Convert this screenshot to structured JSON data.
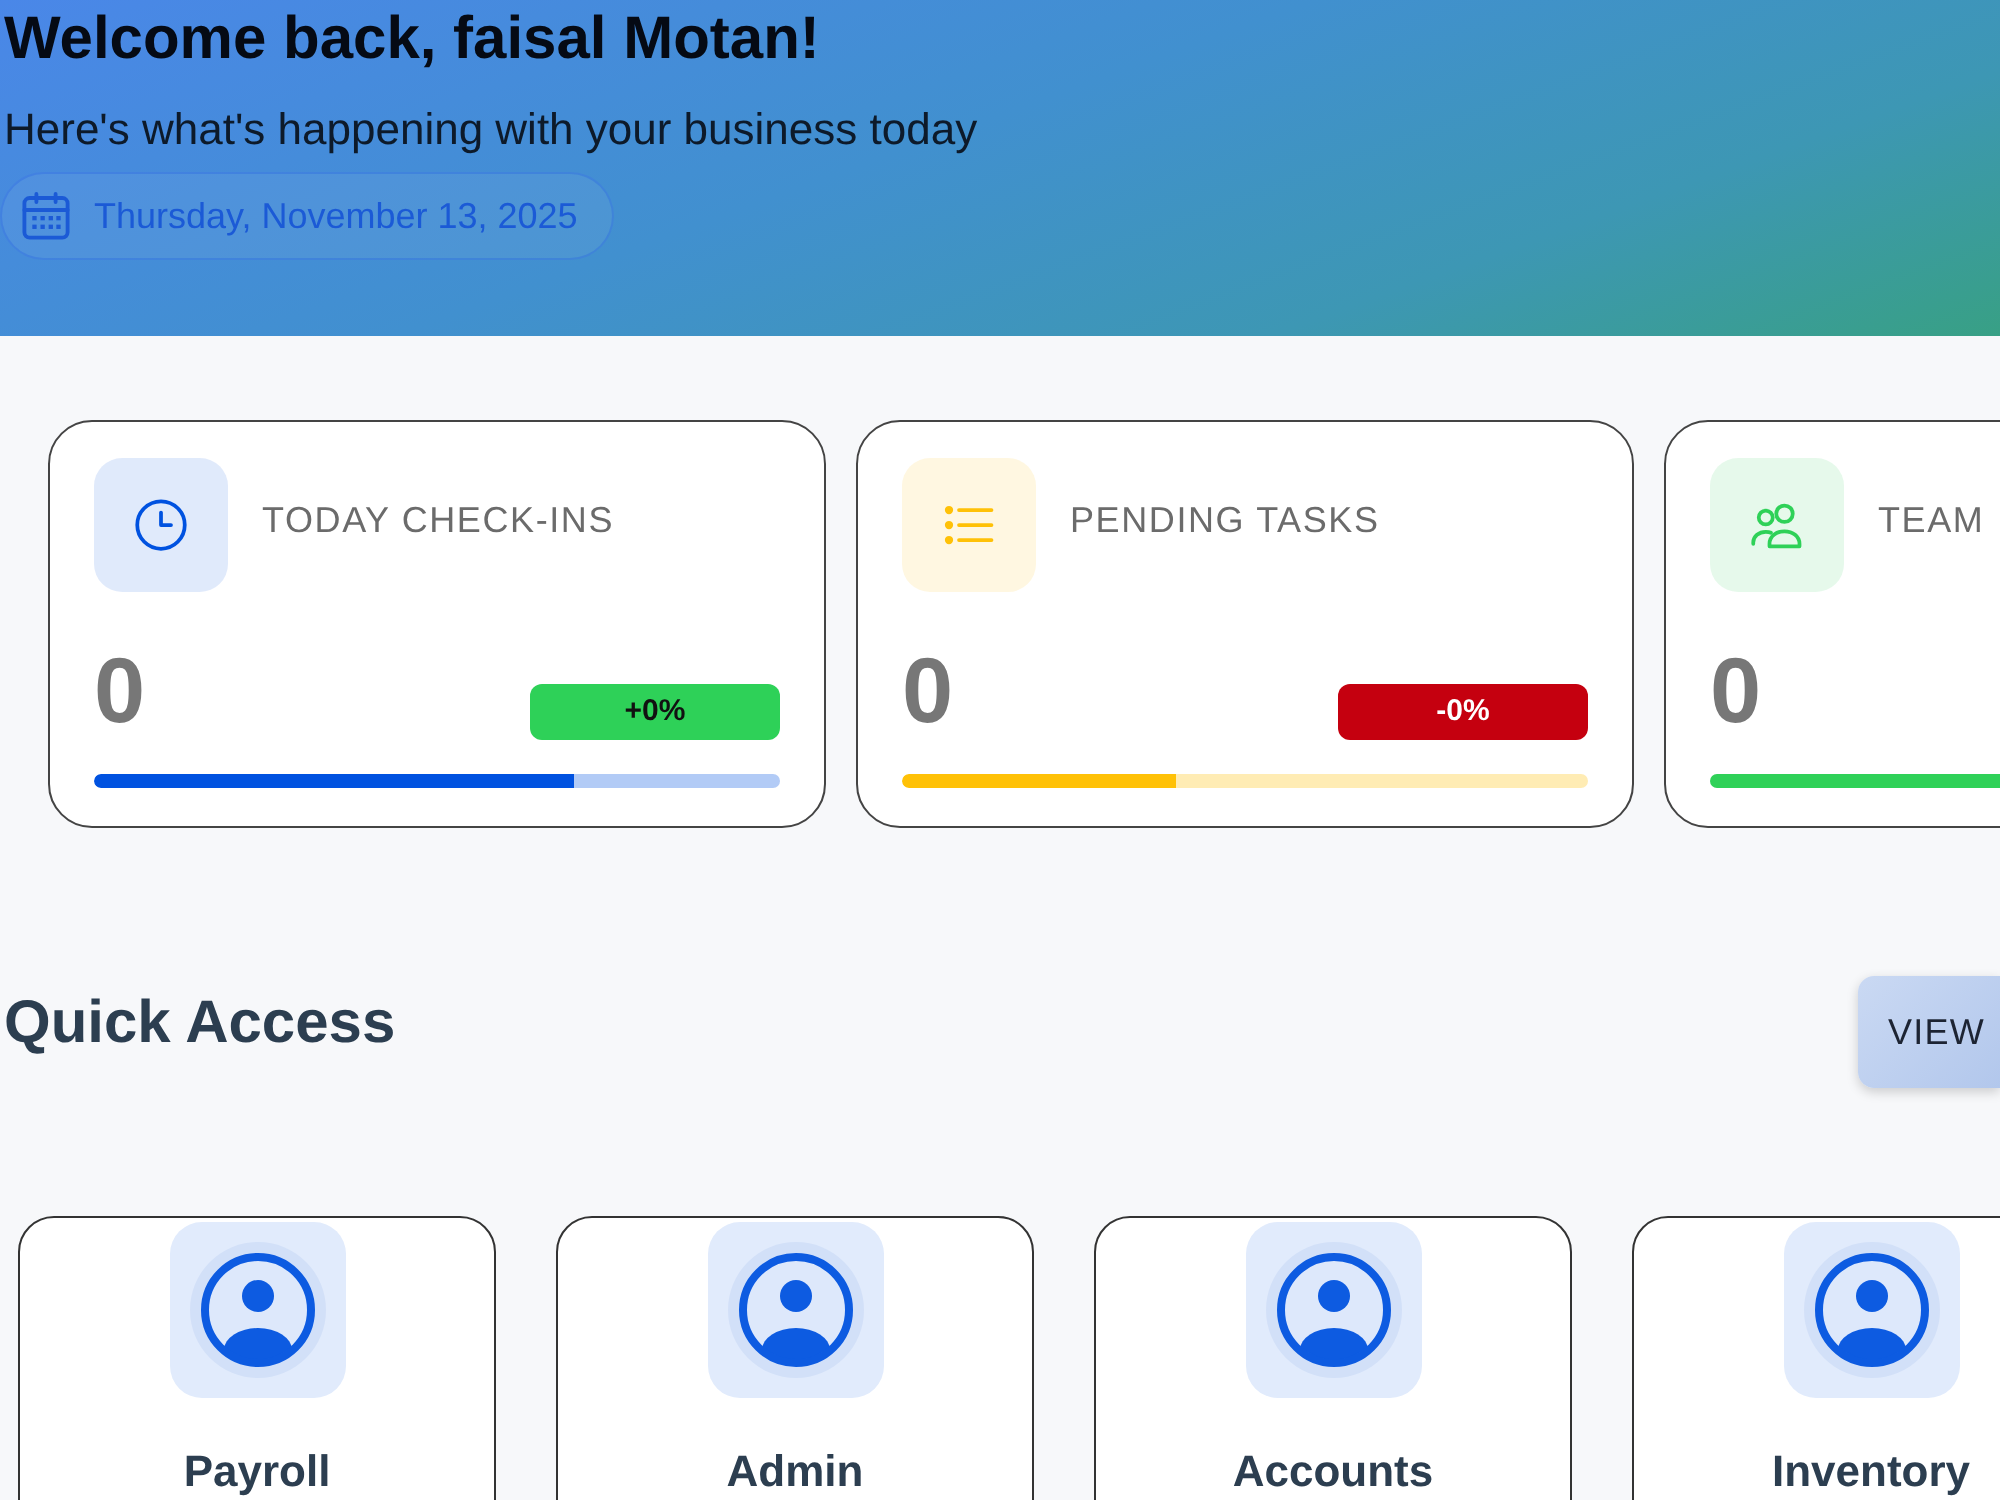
{
  "header": {
    "title": "Welcome back, faisal Motan!",
    "subtitle": "Here's what's happening with your business today",
    "date": "Thursday, November 13, 2025"
  },
  "stats": [
    {
      "kind": "clock",
      "label": "TODAY CHECK-INS",
      "value": "0",
      "color": "#0052e0",
      "level": 0.7,
      "badge": {
        "text": "+0%",
        "kind": "up"
      }
    },
    {
      "kind": "list",
      "label": "PENDING TASKS",
      "value": "0",
      "color": "#ffc107",
      "level": 0.4,
      "badge": {
        "text": "-0%",
        "kind": "down"
      }
    },
    {
      "kind": "team",
      "label": "TEAM",
      "value": "0",
      "color": "#2fd158"
    }
  ],
  "quick_access": {
    "title": "Quick Access",
    "button": "VIEW",
    "modules": [
      {
        "label": "Payroll"
      },
      {
        "label": "Admin"
      },
      {
        "label": "Accounts"
      },
      {
        "label": "Inventory"
      }
    ]
  }
}
